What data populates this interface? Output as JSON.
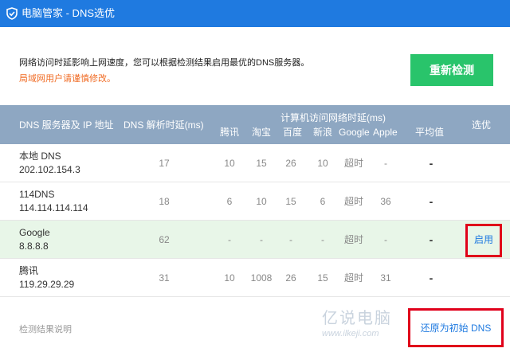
{
  "titlebar": {
    "title": "电脑管家 - DNS选优",
    "icon": "shield-logo-icon"
  },
  "intro": {
    "description": "网络访问时延影响上网速度，您可以根据检测结果启用最优的DNS服务器。",
    "warning": "局域网用户请谨慎修改。"
  },
  "retest_button": "重新检测",
  "table": {
    "col_server": "DNS 服务器及 IP 地址",
    "col_resolve": "DNS 解析时延(ms)",
    "group_title": "计算机访问网络时延(ms)",
    "sub_cols": [
      "腾讯",
      "淘宝",
      "百度",
      "新浪",
      "Google",
      "Apple",
      "平均值"
    ],
    "col_select": "选优",
    "rows": [
      {
        "name": "本地 DNS",
        "ip": "202.102.154.3",
        "resolve": "17",
        "sites": [
          "10",
          "15",
          "26",
          "10",
          "超时",
          "-"
        ],
        "avg": "-",
        "action": ""
      },
      {
        "name": "114DNS",
        "ip": "114.114.114.114",
        "resolve": "18",
        "sites": [
          "6",
          "10",
          "15",
          "6",
          "超时",
          "36"
        ],
        "avg": "-",
        "action": ""
      },
      {
        "name": "Google",
        "ip": "8.8.8.8",
        "resolve": "62",
        "sites": [
          "-",
          "-",
          "-",
          "-",
          "超时",
          "-"
        ],
        "avg": "-",
        "action": "启用"
      },
      {
        "name": "腾讯",
        "ip": "119.29.29.29",
        "resolve": "31",
        "sites": [
          "10",
          "1008",
          "26",
          "15",
          "超时",
          "31"
        ],
        "avg": "-",
        "action": ""
      }
    ]
  },
  "footer": {
    "note": "检测结果说明",
    "restore": "还原为初始 DNS"
  },
  "watermark": {
    "main": "亿说电脑",
    "sub": "www.ilkeji.com"
  },
  "colors": {
    "titlebar": "#1f7ae0",
    "header": "#8ea7c2",
    "accent_green": "#29c46b",
    "warning": "#f06a22",
    "highlight_row": "#e8f6e8",
    "annotation": "#e0001a"
  }
}
